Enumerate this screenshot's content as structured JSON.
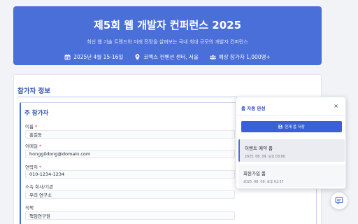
{
  "hero": {
    "title": "제5회 웹 개발자 컨퍼런스 2025",
    "subtitle": "최신 웹 기술 트렌드와 미래 전망을 살펴보는 국내 최대 규모의 개발자 컨퍼런스",
    "date": "2025년 4월 15-16일",
    "location": "코엑스 컨벤션 센터, 서울",
    "attendees": "예상 참가자 1,000명+",
    "icons": [
      "calendar-icon",
      "location-pin-icon",
      "users-icon"
    ]
  },
  "form": {
    "section_title": "참가자 정보",
    "participant_title": "주 참가자",
    "fields": {
      "name": {
        "label": "이름",
        "required_mark": "*",
        "value": "홍길동"
      },
      "email": {
        "label": "이메일",
        "required_mark": "*",
        "value": "honggildong@domain.com"
      },
      "phone": {
        "label": "연락처",
        "required_mark": "*",
        "value": "010-1234-1234"
      },
      "company": {
        "label": "소속 회사/기관",
        "value": "우리 연구소"
      },
      "position": {
        "label": "직책",
        "value": "책임연구원"
      }
    }
  },
  "autofill": {
    "title": "폼 자동 완성",
    "close_label": "×",
    "save_label": "현재 폼 저장",
    "items": [
      {
        "name": "이벤트 예약 폼",
        "date": "2025. 08. 09. 오후 03:00"
      },
      {
        "name": "회원가입 폼",
        "date": "2025. 08. 09. 오후 02:57"
      }
    ]
  },
  "colors": {
    "brand": "#4a6fd9",
    "accent": "#2c4fb3",
    "required": "#e11d48"
  }
}
